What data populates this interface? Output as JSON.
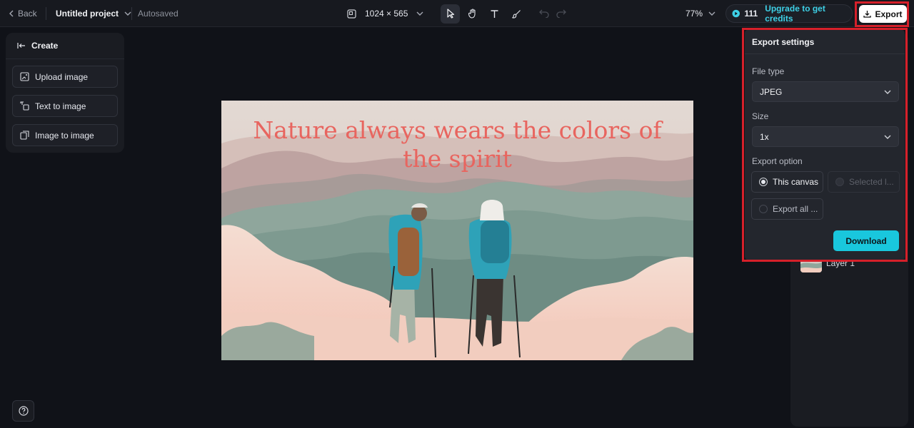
{
  "topbar": {
    "back_label": "Back",
    "project_name": "Untitled project",
    "autosave_status": "Autosaved",
    "canvas_size": "1024 × 565",
    "zoom_level": "77%",
    "credits_count": "111",
    "upgrade_label": "Upgrade to get credits",
    "export_label": "Export"
  },
  "left_panel": {
    "title": "Create",
    "items": [
      {
        "label": "Upload image",
        "icon": "upload-image-icon"
      },
      {
        "label": "Text to image",
        "icon": "text-to-image-icon"
      },
      {
        "label": "Image to image",
        "icon": "image-to-image-icon"
      }
    ]
  },
  "canvas": {
    "title_text": "Nature always wears the colors of the spirit"
  },
  "layers": {
    "items": [
      {
        "label": "Layer 1"
      }
    ]
  },
  "export_settings": {
    "title": "Export settings",
    "file_type_label": "File type",
    "file_type_value": "JPEG",
    "size_label": "Size",
    "size_value": "1x",
    "export_option_label": "Export option",
    "options": [
      {
        "label": "This canvas",
        "selected": true,
        "disabled": false
      },
      {
        "label": "Selected l...",
        "selected": false,
        "disabled": true
      },
      {
        "label": "Export all ...",
        "selected": false,
        "disabled": false
      }
    ],
    "download_label": "Download"
  },
  "colors": {
    "accent": "#19c7dd",
    "highlight": "#d6202a",
    "title_text": "#e8655f"
  }
}
